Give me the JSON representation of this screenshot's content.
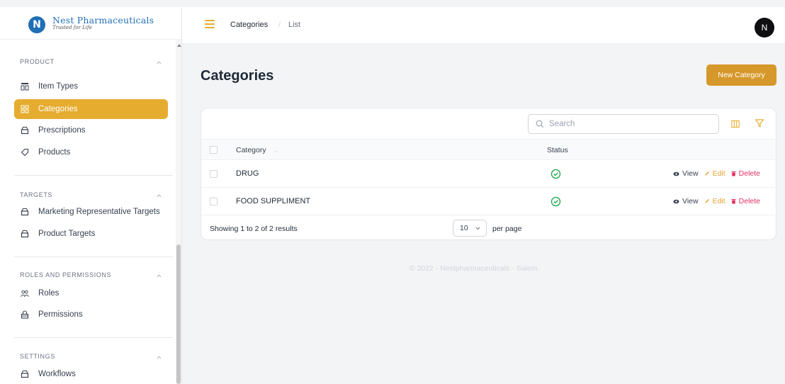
{
  "brand": {
    "name": "Nest Pharmaceuticals",
    "tagline": "Trusted for Life",
    "logo_letter": "N"
  },
  "sidebar": {
    "groups": [
      {
        "title": "PRODUCT",
        "items": [
          {
            "label": "Item Types",
            "icon": "item-types-icon",
            "active": false
          },
          {
            "label": "Categories",
            "icon": "categories-icon",
            "active": true
          },
          {
            "label": "Prescriptions",
            "icon": "prescriptions-icon",
            "active": false
          },
          {
            "label": "Products",
            "icon": "tag-icon",
            "active": false
          }
        ]
      },
      {
        "title": "TARGETS",
        "items": [
          {
            "label": "Marketing Representative Targets",
            "icon": "bag-icon"
          },
          {
            "label": "Product Targets",
            "icon": "bag-icon"
          }
        ]
      },
      {
        "title": "ROLES AND PERMISSIONS",
        "items": [
          {
            "label": "Roles",
            "icon": "users-icon"
          },
          {
            "label": "Permissions",
            "icon": "lock-icon"
          }
        ]
      },
      {
        "title": "SETTINGS",
        "items": [
          {
            "label": "Workflows",
            "icon": "bag-icon"
          }
        ]
      }
    ]
  },
  "topbar": {
    "breadcrumb": [
      "Categories",
      "List"
    ],
    "avatar_letter": "N"
  },
  "main": {
    "title": "Categories",
    "new_button": "New Category",
    "search_placeholder": "Search",
    "columns": [
      "Category",
      "Status"
    ],
    "rows": [
      {
        "category": "DRUG",
        "status": "active"
      },
      {
        "category": "FOOD SUPPLIMENT",
        "status": "active"
      }
    ],
    "actions": {
      "view": "View",
      "edit": "Edit",
      "delete": "Delete"
    },
    "pagination": {
      "showing": "Showing 1 to 2 of 2 results",
      "per_page_value": "10",
      "per_page_label": "per page"
    }
  },
  "footer": {
    "copyright": "© 2022 - Nestpharmaceuticals - Salem"
  },
  "colors": {
    "accent": "#e6ac30",
    "primary_button": "#d6982b",
    "success": "#16a34a",
    "danger": "#e0325f",
    "brand_blue": "#1f6fb5"
  }
}
